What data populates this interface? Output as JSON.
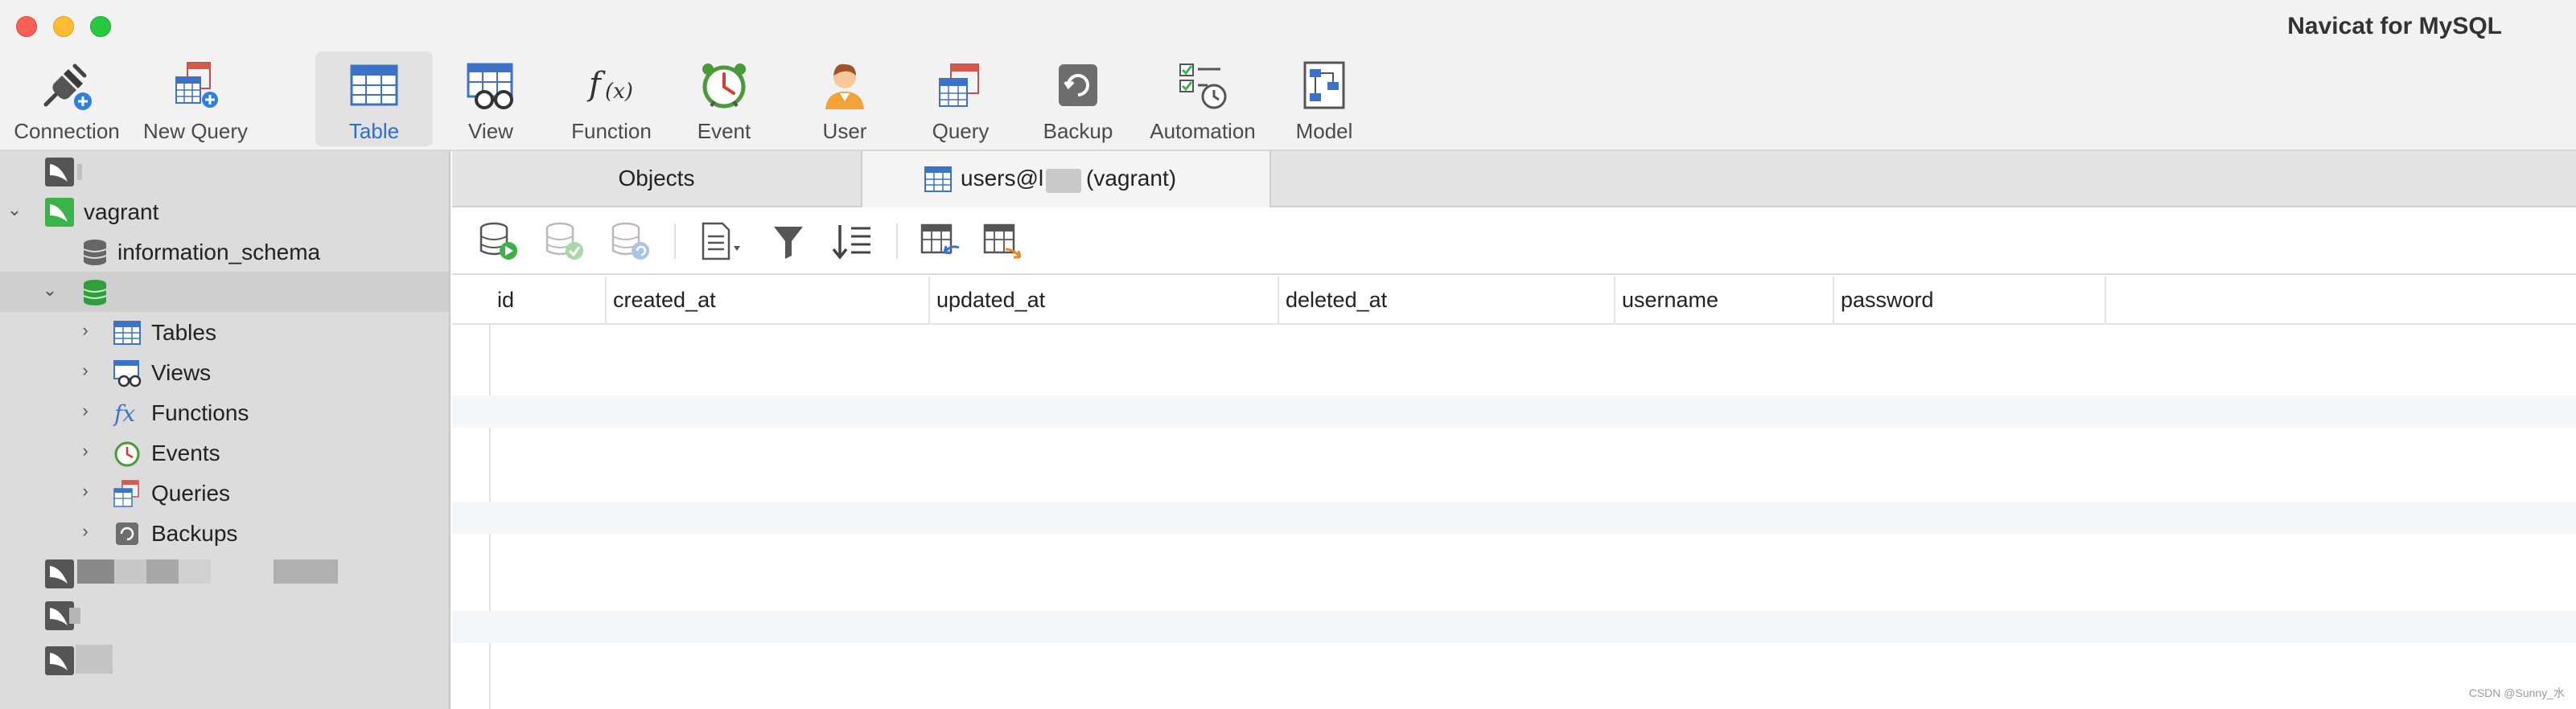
{
  "window": {
    "title": "Navicat for MySQL"
  },
  "toolbar": {
    "items": [
      {
        "label": "Connection",
        "icon": "plug-icon"
      },
      {
        "label": "New Query",
        "icon": "new-query-icon"
      },
      {
        "label": "Table",
        "icon": "table-icon",
        "active": true
      },
      {
        "label": "View",
        "icon": "view-icon"
      },
      {
        "label": "Function",
        "icon": "function-icon"
      },
      {
        "label": "Event",
        "icon": "event-clock-icon"
      },
      {
        "label": "User",
        "icon": "user-icon"
      },
      {
        "label": "Query",
        "icon": "query-icon"
      },
      {
        "label": "Backup",
        "icon": "backup-icon"
      },
      {
        "label": "Automation",
        "icon": "automation-icon"
      },
      {
        "label": "Model",
        "icon": "model-icon"
      }
    ]
  },
  "sidebar": {
    "connection": "vagrant",
    "schema": "information_schema",
    "children": [
      "Tables",
      "Views",
      "Functions",
      "Events",
      "Queries",
      "Backups"
    ]
  },
  "tabs": {
    "objects": "Objects",
    "active_prefix": "users@l",
    "active_suffix": "(vagrant)"
  },
  "grid": {
    "columns": [
      "id",
      "created_at",
      "updated_at",
      "deleted_at",
      "username",
      "password"
    ]
  },
  "watermark": "CSDN @Sunny_水",
  "colors": {
    "accent": "#2a6fd6",
    "sidebar_bg": "#dcdcdc",
    "mysql_green": "#3bb34a"
  }
}
